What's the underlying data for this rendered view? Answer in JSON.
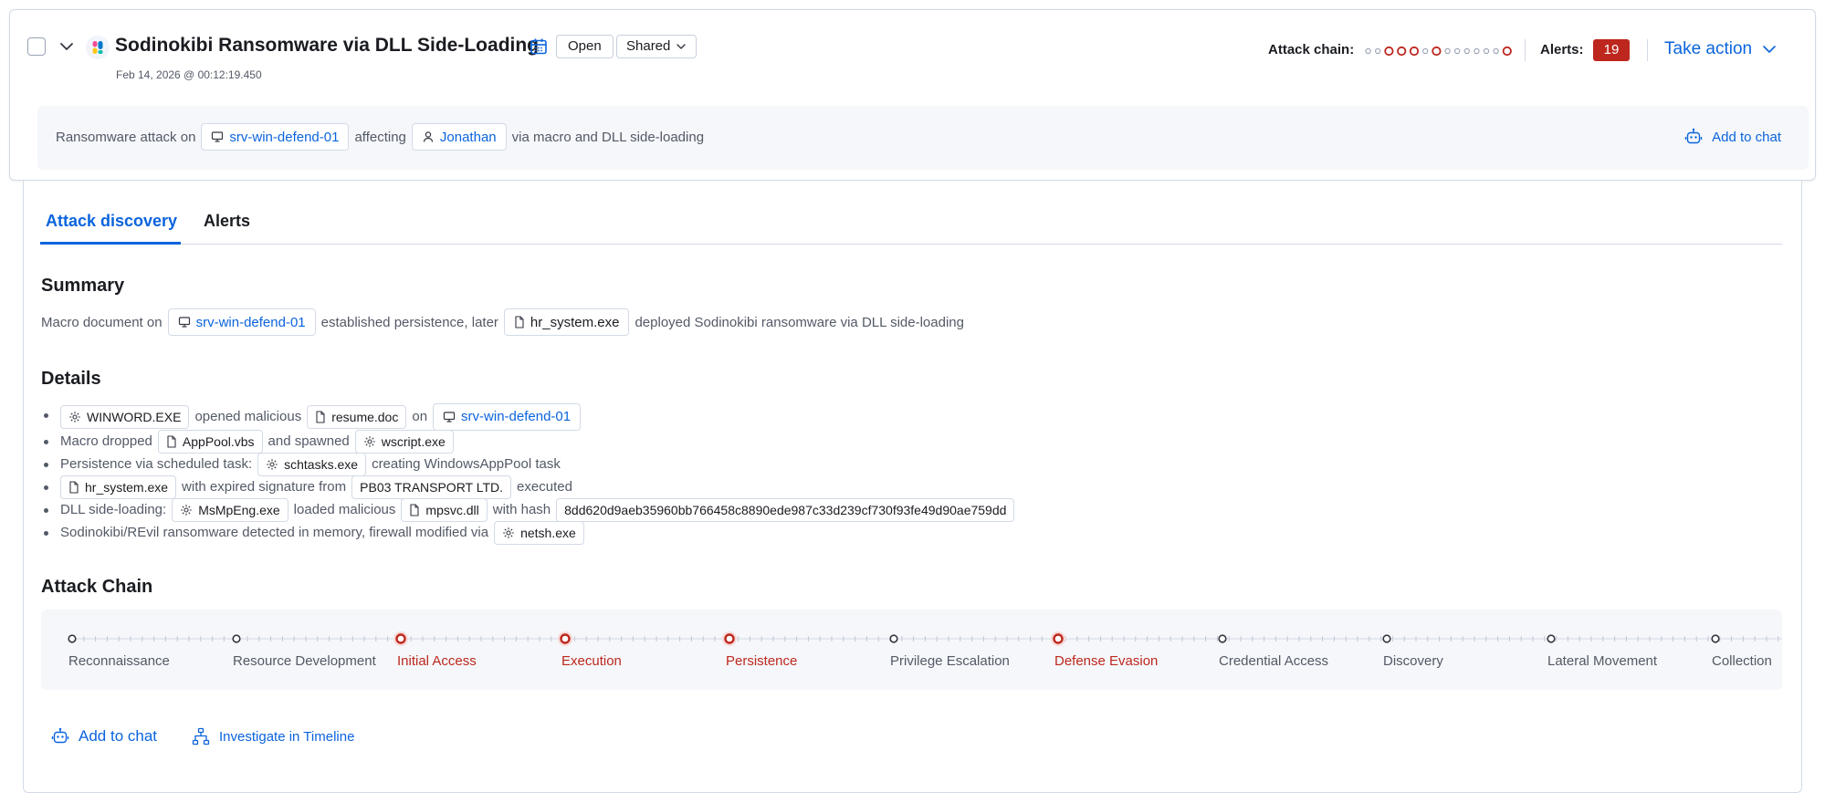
{
  "header": {
    "title": "Sodinokibi Ransomware via DLL Side-Loading",
    "status_badge": "Open",
    "sharing_label": "Shared",
    "timestamp": "Feb 14, 2026 @ 00:12:19.450",
    "attack_chain_label": "Attack chain:",
    "alerts_label": "Alerts:",
    "alerts_count": "19",
    "take_action_label": "Take action"
  },
  "summary_band": {
    "t1": "Ransomware attack on",
    "host": "srv-win-defend-01",
    "t2": "affecting",
    "user": "Jonathan",
    "t3": "via macro and DLL side-loading",
    "add_to_chat": "Add to chat"
  },
  "tabs": [
    {
      "label": "Attack discovery",
      "active": true
    },
    {
      "label": "Alerts",
      "active": false
    }
  ],
  "summary": {
    "heading": "Summary",
    "t1": "Macro document on",
    "host": "srv-win-defend-01",
    "t2": "established persistence, later",
    "file": "hr_system.exe",
    "t3": "deployed Sodinokibi ransomware via DLL side-loading"
  },
  "details": {
    "heading": "Details",
    "rows": [
      {
        "a": "WINWORD.EXE",
        "t1": "opened malicious",
        "b": "resume.doc",
        "t2": "on",
        "c": "srv-win-defend-01"
      },
      {
        "t0": "Macro dropped",
        "a": "AppPool.vbs",
        "t1": "and spawned",
        "b": "wscript.exe"
      },
      {
        "t0": "Persistence via scheduled task:",
        "a": "schtasks.exe",
        "t1": "creating WindowsAppPool task"
      },
      {
        "a": "hr_system.exe",
        "t1": "with expired signature from",
        "b": "PB03 TRANSPORT LTD.",
        "t2": "executed"
      },
      {
        "t0": "DLL side-loading:",
        "a": "MsMpEng.exe",
        "t1": "loaded malicious",
        "b": "mpsvc.dll",
        "t2": "with hash",
        "c": "8dd620d9aeb35960bb766458c8890ede987c33d239cf730f93fe49d90ae759dd"
      },
      {
        "t0": "Sodinokibi/REvil ransomware detected in memory, firewall modified via",
        "a": "netsh.exe"
      }
    ]
  },
  "attack_chain": {
    "heading": "Attack Chain",
    "tactics": [
      {
        "name": "Reconnaissance",
        "detected": false
      },
      {
        "name": "Resource Development",
        "detected": false
      },
      {
        "name": "Initial Access",
        "detected": true
      },
      {
        "name": "Execution",
        "detected": true
      },
      {
        "name": "Persistence",
        "detected": true
      },
      {
        "name": "Privilege Escalation",
        "detected": false
      },
      {
        "name": "Defense Evasion",
        "detected": true
      },
      {
        "name": "Credential Access",
        "detected": false
      },
      {
        "name": "Discovery",
        "detected": false
      },
      {
        "name": "Lateral Movement",
        "detected": false
      },
      {
        "name": "Collection",
        "detected": false
      }
    ],
    "mini_pattern": [
      false,
      false,
      true,
      true,
      true,
      false,
      true,
      false,
      false,
      false,
      false,
      false,
      false,
      true
    ]
  },
  "actions": {
    "add_to_chat": "Add to chat",
    "investigate": "Investigate in Timeline"
  },
  "colors": {
    "accent": "#0b64dd",
    "danger": "#bd271e",
    "muted_dot": "#343741"
  }
}
